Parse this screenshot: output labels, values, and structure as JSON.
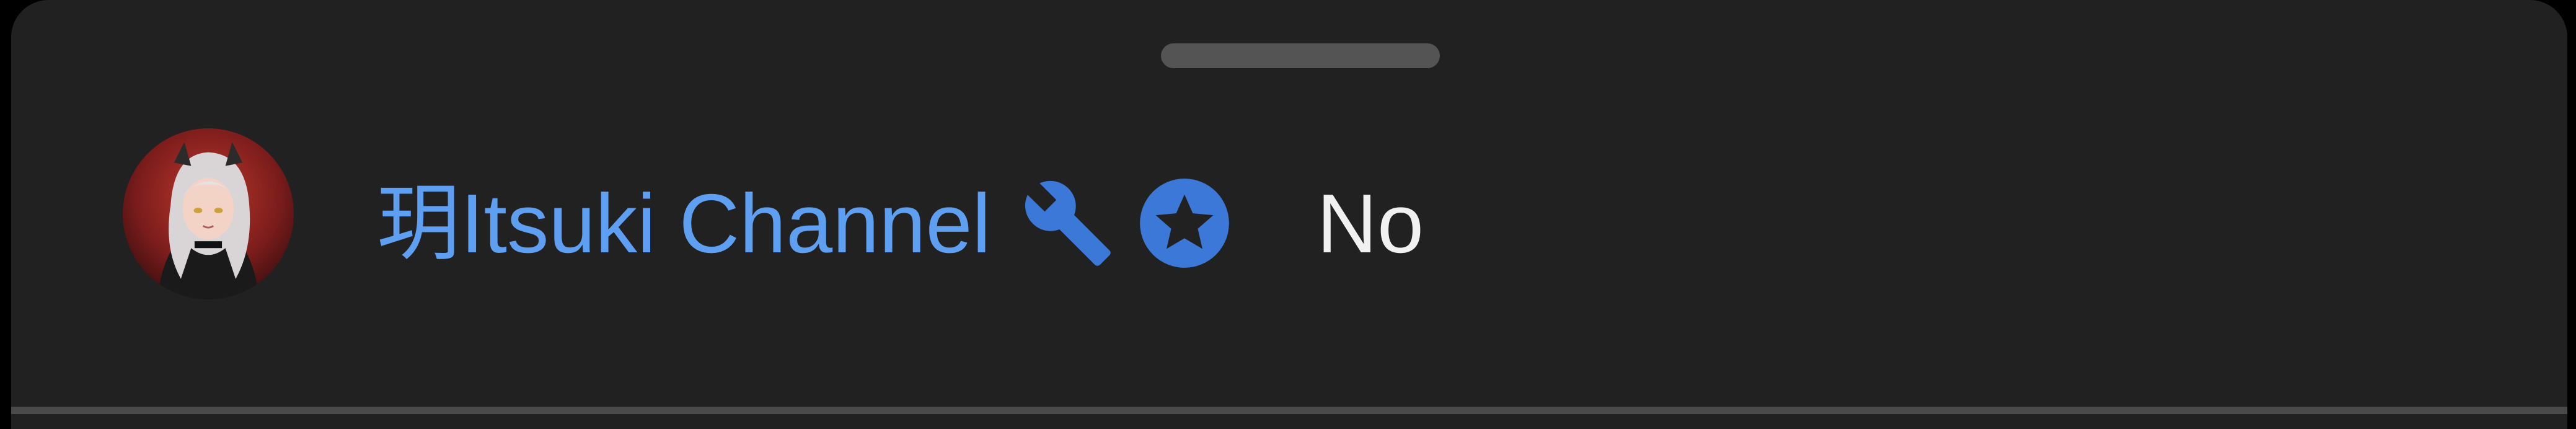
{
  "chat_message": {
    "author_name": "玥Itsuki Channel",
    "message": "No",
    "badges": {
      "moderator_icon": "wrench-icon",
      "member_icon": "star-badge-icon"
    }
  },
  "colors": {
    "sheet_background": "#212121",
    "author_name": "#5e9ff2",
    "badge": "#3b78d8",
    "message_text": "#f1f1f1",
    "drag_handle": "#545454"
  }
}
